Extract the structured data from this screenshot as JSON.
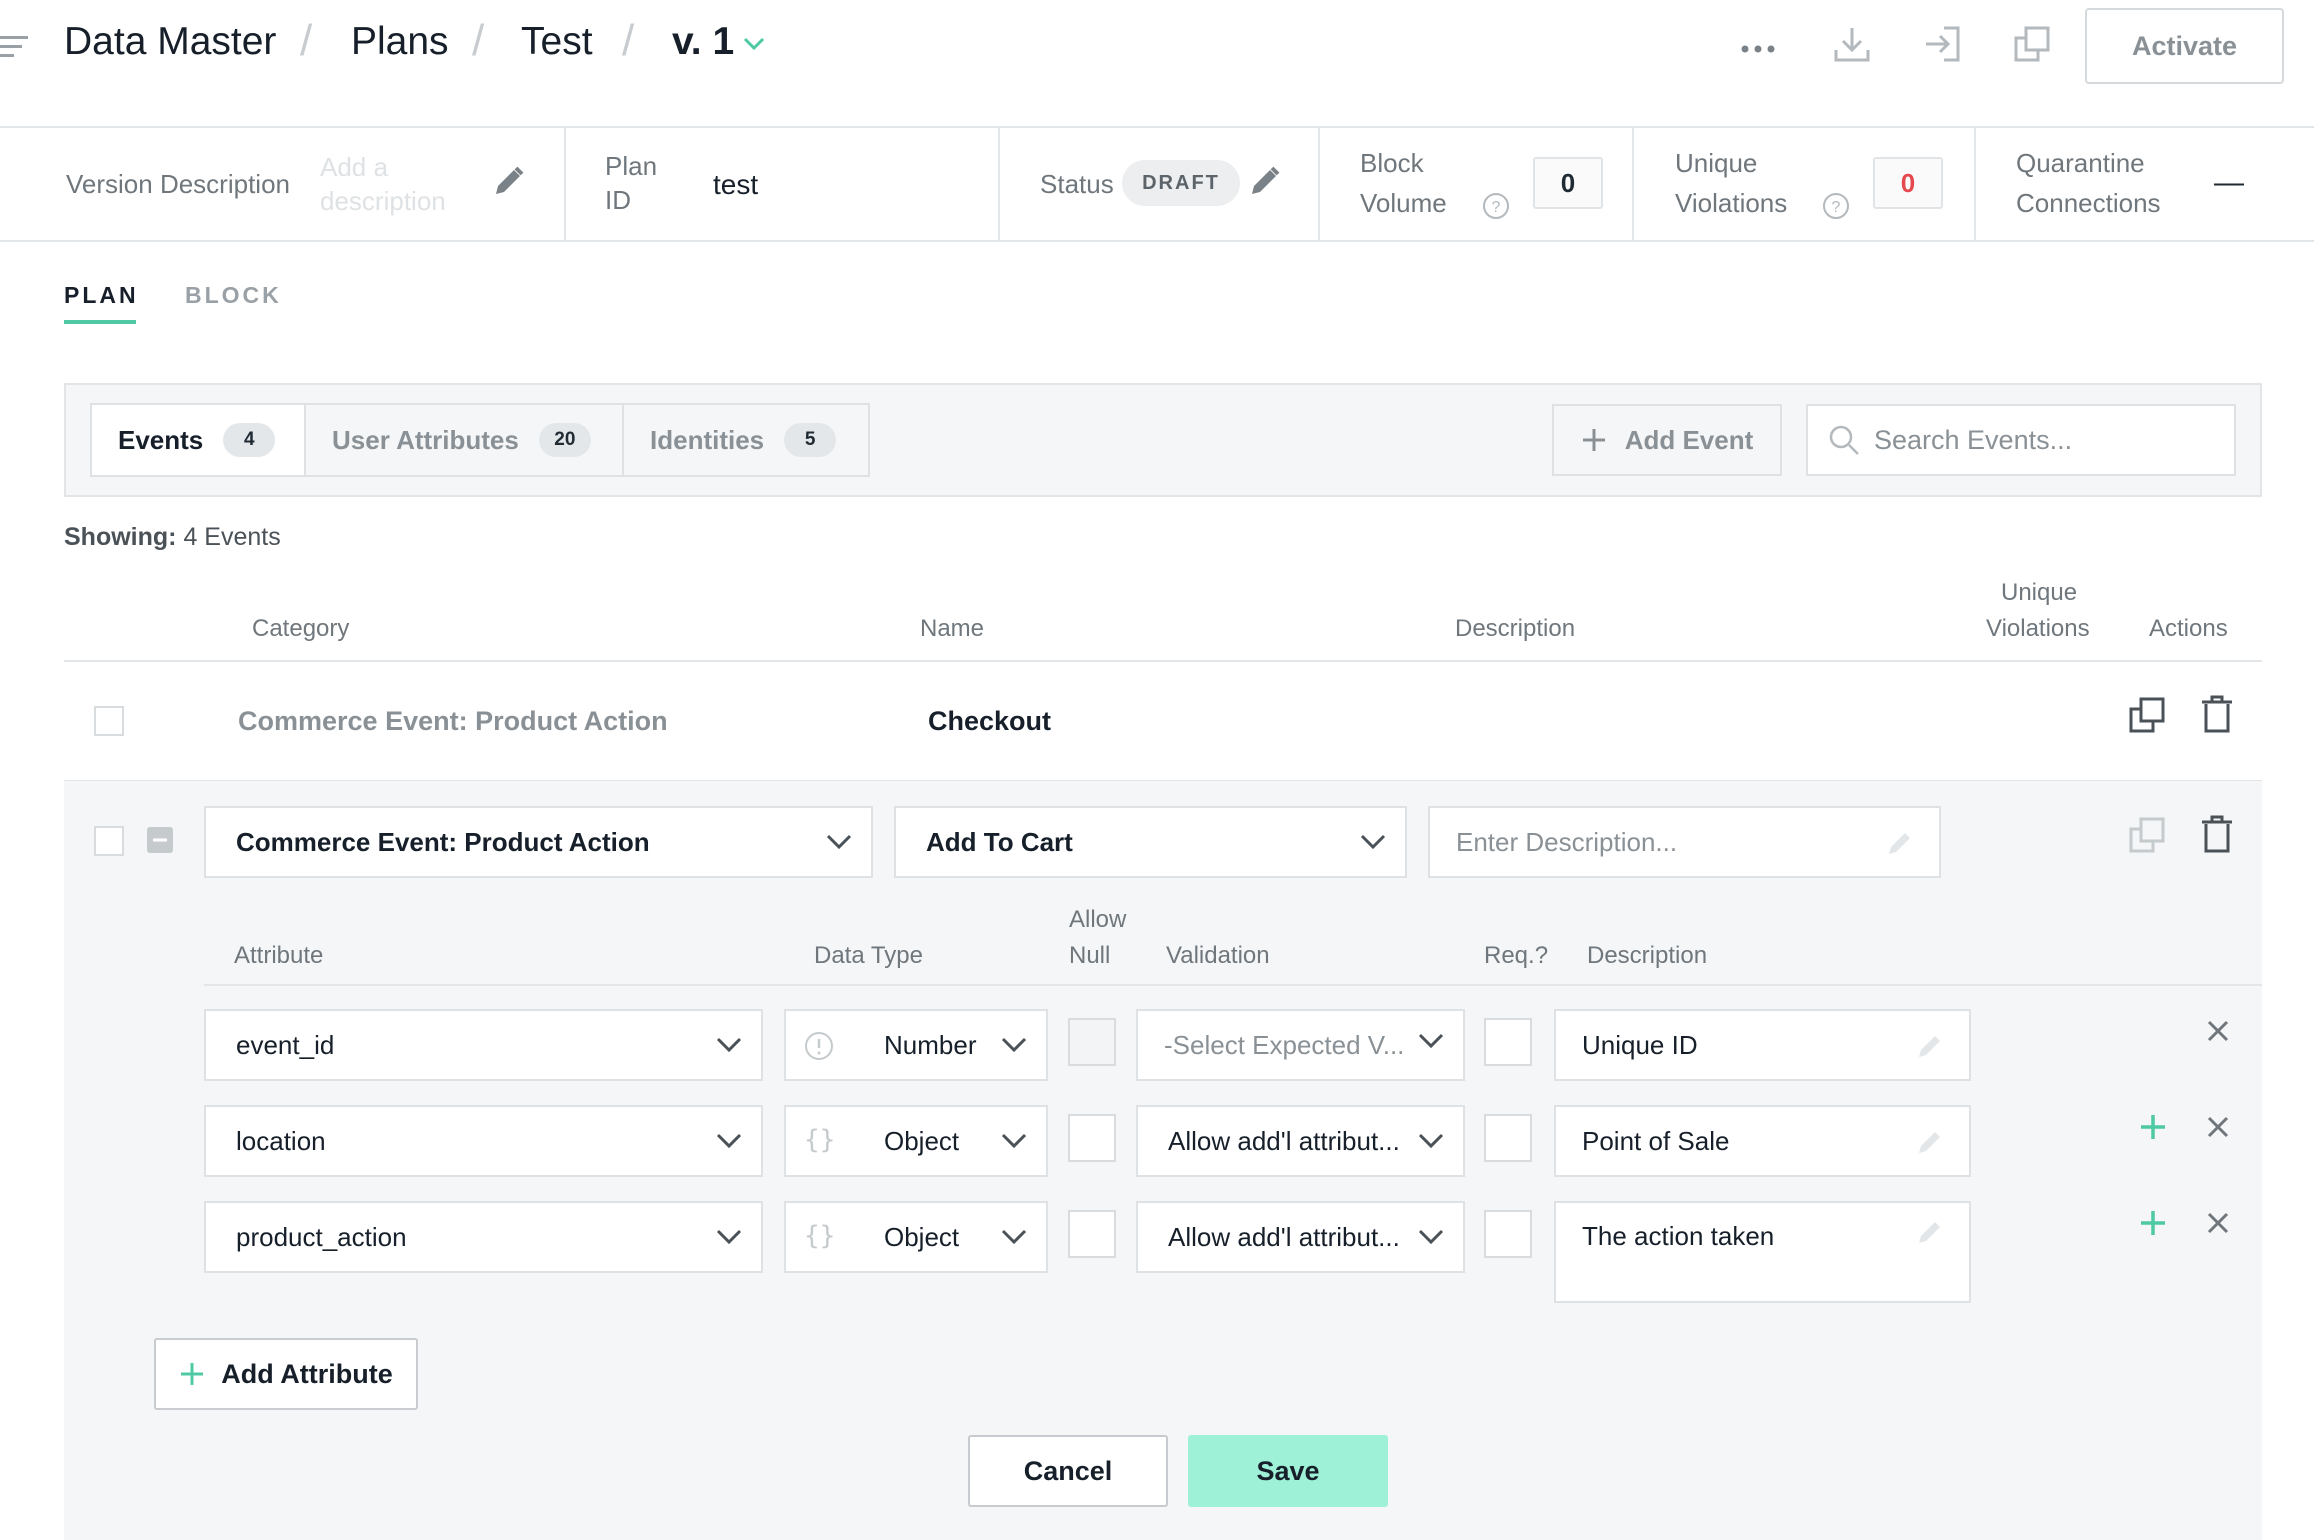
{
  "breadcrumb": [
    "Data Master",
    "Plans",
    "Test",
    "v. 1"
  ],
  "header": {
    "activate_label": "Activate"
  },
  "info": {
    "version_description_label": "Version Description",
    "version_description_placeholder_1": "Add a",
    "version_description_placeholder_2": "description",
    "plan_id_label_1": "Plan",
    "plan_id_label_2": "ID",
    "plan_id_value": "test",
    "status_label": "Status",
    "status_value": "DRAFT",
    "block_volume_label_1": "Block",
    "block_volume_label_2": "Volume",
    "block_volume_value": "0",
    "unique_violations_label_1": "Unique",
    "unique_violations_label_2": "Violations",
    "unique_violations_value": "0",
    "quarantine_label_1": "Quarantine",
    "quarantine_label_2": "Connections",
    "quarantine_value": "—"
  },
  "page_tabs": [
    "PLAN",
    "BLOCK"
  ],
  "sub_tabs": [
    {
      "label": "Events",
      "count": "4"
    },
    {
      "label": "User Attributes",
      "count": "20"
    },
    {
      "label": "Identities",
      "count": "5"
    }
  ],
  "add_event_label": "Add Event",
  "search_placeholder": "Search Events...",
  "showing": {
    "label": "Showing:",
    "value": "4 Events"
  },
  "columns": {
    "category": "Category",
    "name": "Name",
    "description": "Description",
    "unique_violations_1": "Unique",
    "unique_violations_2": "Violations",
    "actions": "Actions"
  },
  "rows": [
    {
      "category": "Commerce Event: Product Action",
      "name": "Checkout"
    }
  ],
  "edit_row": {
    "category": "Commerce Event: Product Action",
    "name": "Add To Cart",
    "description_placeholder": "Enter Description..."
  },
  "attr_columns": {
    "attribute": "Attribute",
    "data_type": "Data Type",
    "allow_null_1": "Allow",
    "allow_null_2": "Null",
    "validation": "Validation",
    "required": "Req.?",
    "description": "Description"
  },
  "attributes": [
    {
      "name": "event_id",
      "type": "Number",
      "type_icon": "info-icon",
      "validation": "-Select Expected V...",
      "description": "Unique ID"
    },
    {
      "name": "location",
      "type": "Object",
      "type_icon": "braces-icon",
      "validation": "Allow add'l attribut...",
      "description": "Point of Sale"
    },
    {
      "name": "product_action",
      "type": "Object",
      "type_icon": "braces-icon",
      "validation": "Allow add'l attribut...",
      "description": "The action taken"
    }
  ],
  "add_attribute_label": "Add Attribute",
  "cancel_label": "Cancel",
  "save_label": "Save",
  "colors": {
    "accent": "#4fc9a3",
    "save_bg": "#9ef0d7",
    "violation_red": "#e5484d",
    "border": "#e3e6e8"
  }
}
